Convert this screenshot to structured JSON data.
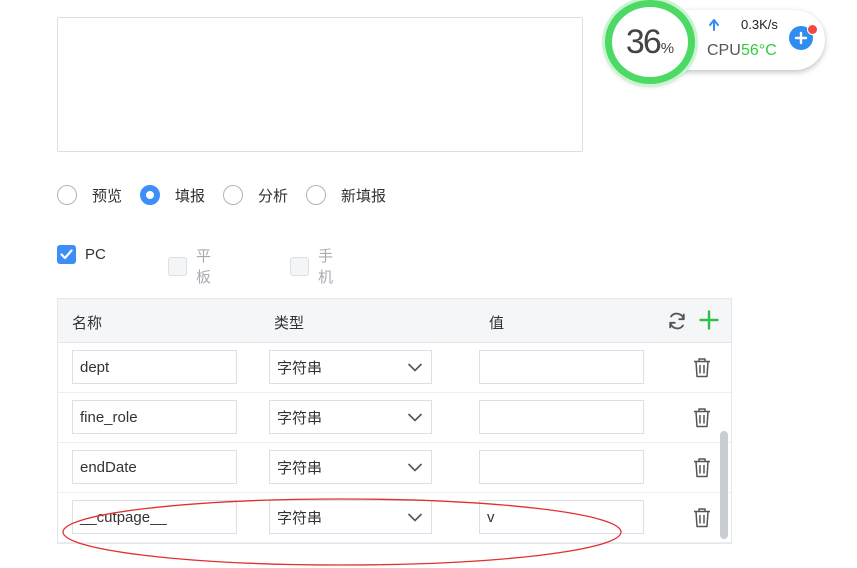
{
  "monitor": {
    "usage_value": "36",
    "usage_unit": "%",
    "net_speed": "0.3K/s",
    "cpu_label": "CPU",
    "cpu_temp": "56°C",
    "colors": {
      "gauge": "#4cd964",
      "temp": "#2ecc40",
      "boost": "#2f8cf0",
      "notify": "#f04a3c"
    }
  },
  "mode_radios": [
    {
      "label": "预览",
      "checked": false
    },
    {
      "label": "填报",
      "checked": true
    },
    {
      "label": "分析",
      "checked": false
    },
    {
      "label": "新填报",
      "checked": false
    }
  ],
  "terminals": [
    {
      "label": "PC",
      "checked": true,
      "disabled": false
    },
    {
      "label": "平板",
      "checked": false,
      "disabled": true
    },
    {
      "label": "手机",
      "checked": false,
      "disabled": true
    }
  ],
  "params_table": {
    "headers": {
      "name": "名称",
      "type": "类型",
      "value": "值"
    },
    "rows": [
      {
        "name": "dept",
        "type": "字符串",
        "value": ""
      },
      {
        "name": "fine_role",
        "type": "字符串",
        "value": ""
      },
      {
        "name": "endDate",
        "type": "字符串",
        "value": ""
      },
      {
        "name": "__cutpage__",
        "type": "字符串",
        "value": "v"
      }
    ]
  },
  "colors": {
    "accent": "#3e8ef7",
    "add": "#2fbf4a",
    "annotation": "#e03030"
  }
}
